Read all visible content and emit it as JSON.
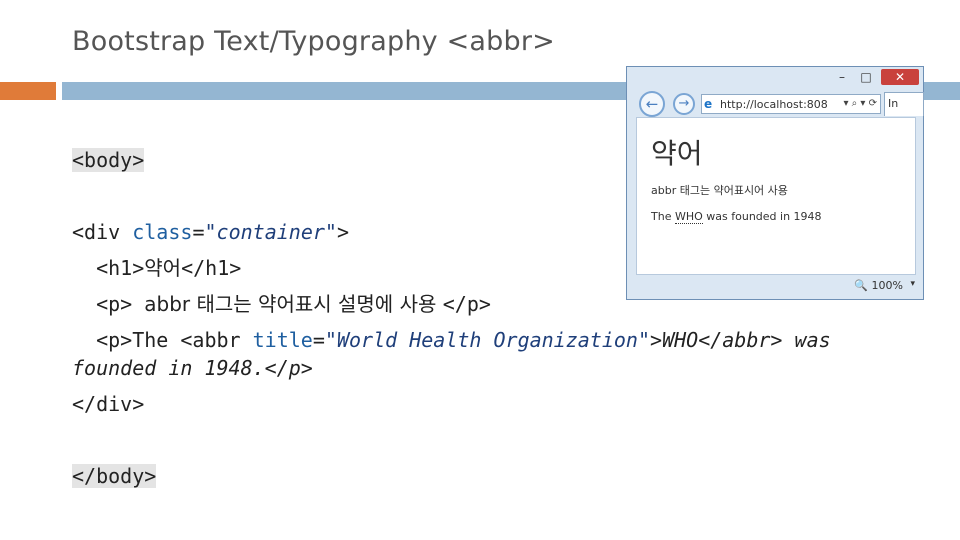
{
  "slide": {
    "title": "Bootstrap Text/Typography <abbr>"
  },
  "code": {
    "body_open": "<body>",
    "div_open_tag": "<div ",
    "div_attr": "class",
    "div_eq": "=",
    "div_val": "\"container\"",
    "div_close_bracket": ">",
    "h1_indent": "  ",
    "h1_open": "<h1>",
    "h1_text": "약어",
    "h1_close": "</h1>",
    "p1_indent": "  ",
    "p1_open": "<p> ",
    "p1_text": "abbr 태그는 약어표시 설명에 사용 ",
    "p1_close": "</p>",
    "p2_indent": "  ",
    "p2_open": "<p>",
    "p2_text1": "The ",
    "p2_abbr_open": "<abbr ",
    "p2_attr": "title",
    "p2_eq": "=",
    "p2_val": "\"World Health Organization\"",
    "p2_bracket": ">",
    "p2_abbr_text": "WHO",
    "p2_abbr_close": "</abbr>",
    "p2_text2": " was",
    "p2_line2_text": "founded in 1948.",
    "p2_close": "</p>",
    "div_close": "</div>",
    "body_close": "</body>"
  },
  "browser": {
    "min_label": "–",
    "max_label": "□",
    "close_label": "✕",
    "back_icon": "back-arrow-icon",
    "back_glyph": "←",
    "forward_icon": "forward-arrow-icon",
    "forward_glyph": "→",
    "ie_glyph": "e",
    "url": "http://localhost:808",
    "addr_tools": "▾ ⌕ ▾ ⟳",
    "tab_label": "In",
    "page_h1": "약어",
    "page_p1": "abbr 태그는 약어표시어 사용",
    "page_p2_before": "The ",
    "page_p2_abbr": "WHO",
    "page_p2_after": " was founded in 1948",
    "zoom": "🔍 100%",
    "zoom_arrow": "▾"
  },
  "colors": {
    "accent_orange": "#e07b39",
    "accent_blue": "#94b6d2",
    "close_red": "#c9413c"
  }
}
